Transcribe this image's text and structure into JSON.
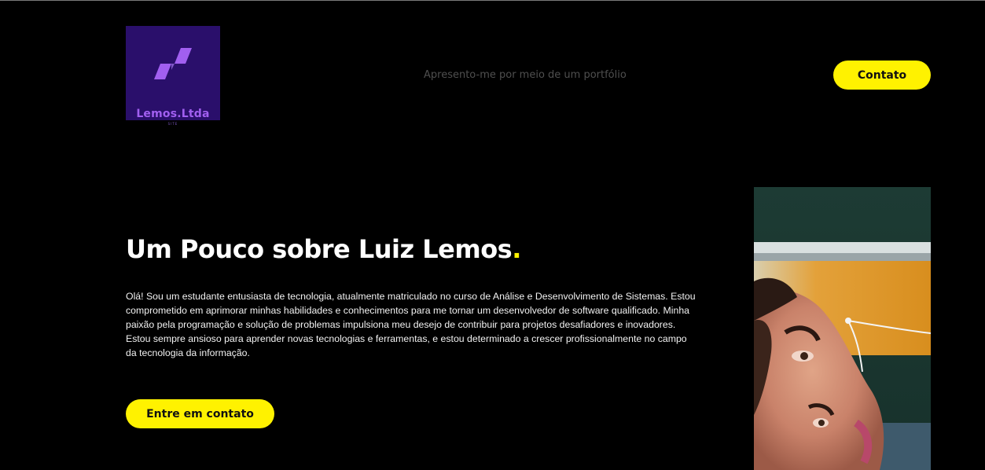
{
  "brand": {
    "logo_text": "Lemos.Ltda",
    "logo_sub": "SITE",
    "logo_bg": "#2a0f6b",
    "logo_color": "#a15ff0"
  },
  "header": {
    "tagline": "Apresento-me por meio de um portfólio",
    "contact_label": "Contato"
  },
  "hero": {
    "title": "Um Pouco sobre Luiz Lemos",
    "title_dot": ".",
    "bio": "Olá! Sou um estudante entusiasta de tecnologia, atualmente matriculado no curso de Análise e Desenvolvimento de Sistemas. Estou comprometido em aprimorar minhas habilidades e conhecimentos para me tornar um desenvolvedor de software qualificado. Minha paixão pela programação e solução de problemas impulsiona meu desejo de contribuir para projetos desafiadores e inovadores. Estou sempre ansioso para aprender novas tecnologias e ferramentas, e estou determinado a crescer profissionalmente no campo da tecnologia da informação.",
    "cta_label": "Entre em contato"
  },
  "colors": {
    "background": "#000000",
    "accent": "#fff200",
    "text": "#ffffff",
    "muted": "#4f4f4f"
  },
  "icons": [
    "lemos-logo-icon",
    "profile-photo"
  ]
}
